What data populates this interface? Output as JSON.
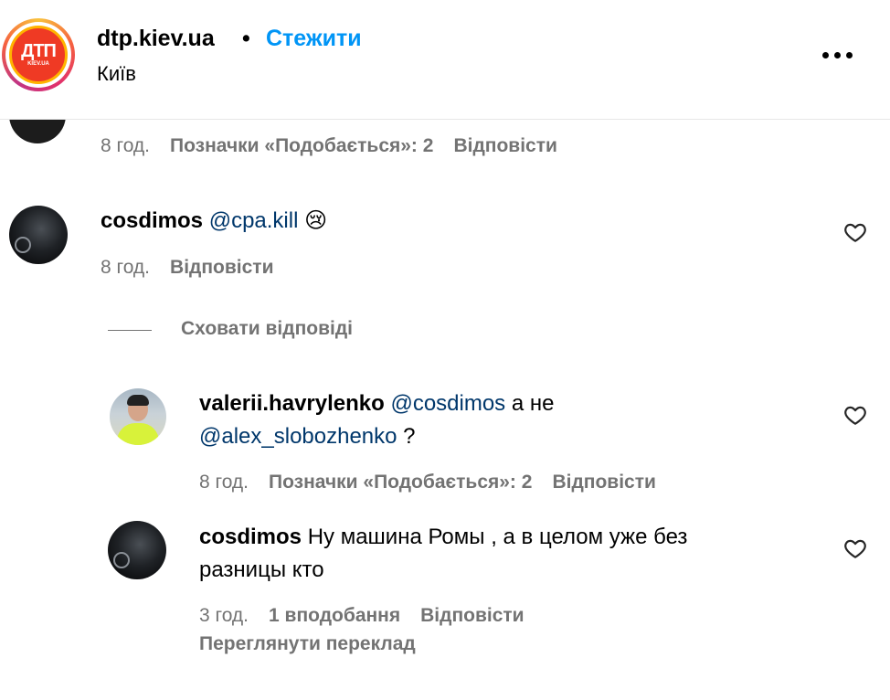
{
  "post_header": {
    "username": "dtp.kiev.ua",
    "separator": "•",
    "follow_label": "Стежити",
    "location": "Київ",
    "logo_text": "ДТП",
    "logo_subtext": "KIEV.UA"
  },
  "colors": {
    "follow": "#0095f6",
    "mention": "#00376b",
    "meta": "#737373"
  },
  "comments": [
    {
      "time": "8 год.",
      "likes": "Позначки «Подобається»: 2",
      "reply": "Відповісти"
    },
    {
      "username": "cosdimos",
      "mention": "@cpa.kill",
      "emoji": "😢",
      "time": "8 год.",
      "reply": "Відповісти",
      "hide_replies": "Сховати відповіді",
      "replies": [
        {
          "username": "valerii.havrylenko",
          "mention1": "@cosdimos",
          "text1": " а не",
          "mention2": "@alex_slobozhenko",
          "text2": " ?",
          "time": "8 год.",
          "likes": "Позначки «Подобається»: 2",
          "reply": "Відповісти"
        },
        {
          "username": "cosdimos",
          "text_line1": " Ну машина Ромы , а в целом уже без",
          "text_line2": "разницы кто",
          "time": "3 год.",
          "likes": "1 вподобання",
          "reply": "Відповісти",
          "translate": "Переглянути переклад"
        }
      ]
    }
  ],
  "icons": {
    "more": "more-horizontal-icon",
    "like": "heart-outline-icon"
  }
}
